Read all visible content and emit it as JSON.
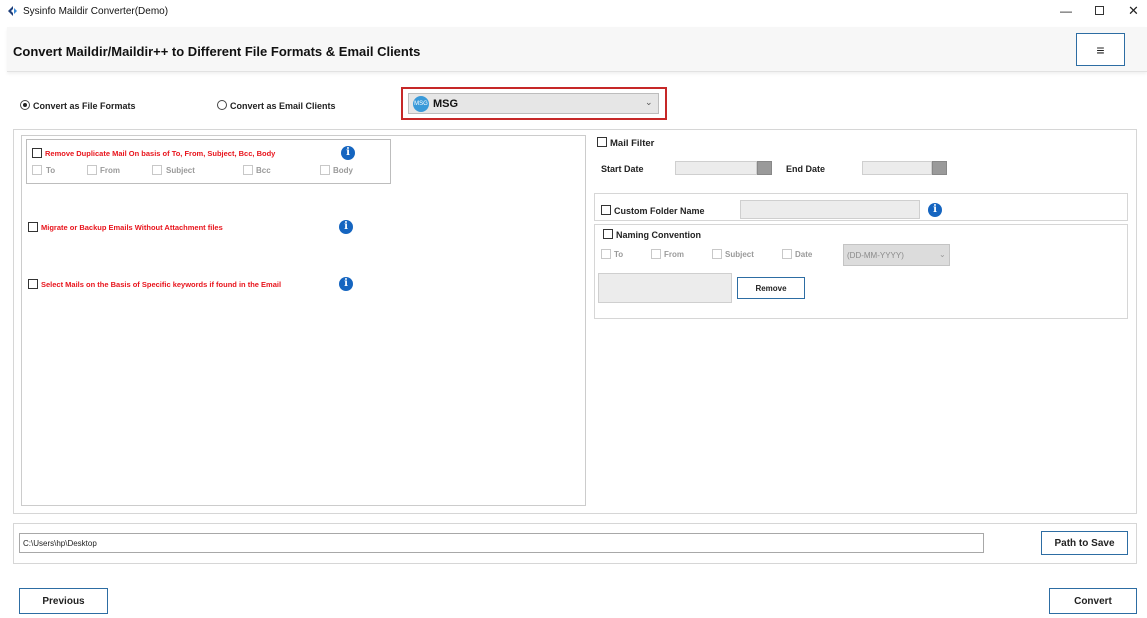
{
  "window": {
    "title": "Sysinfo Maildir Converter(Demo)"
  },
  "header": {
    "title": "Convert Maildir/Maildir++ to Different File Formats & Email Clients"
  },
  "mode": {
    "option1": "Convert as File Formats",
    "option2": "Convert as Email Clients",
    "selected": "Convert as File Formats"
  },
  "format_select": {
    "badge": "MSG",
    "value": "MSG"
  },
  "left": {
    "dup_label": "Remove Duplicate Mail On basis of To, From, Subject, Bcc, Body",
    "dup_fields": [
      "To",
      "From",
      "Subject",
      "Bcc",
      "Body"
    ],
    "attach_label": "Migrate or Backup Emails Without Attachment files",
    "keyword_label": "Select Mails on the Basis of Specific keywords if found in the Email"
  },
  "right": {
    "mail_filter": "Mail Filter",
    "start_date": "Start Date",
    "end_date": "End Date",
    "custom_folder": "Custom Folder Name",
    "naming": "Naming Convention",
    "naming_fields": [
      "To",
      "From",
      "Subject",
      "Date"
    ],
    "date_format": "(DD-MM-YYYY)",
    "remove": "Remove"
  },
  "path": {
    "value": "C:\\Users\\hp\\Desktop",
    "button": "Path to Save"
  },
  "footer": {
    "previous": "Previous",
    "convert": "Convert"
  }
}
